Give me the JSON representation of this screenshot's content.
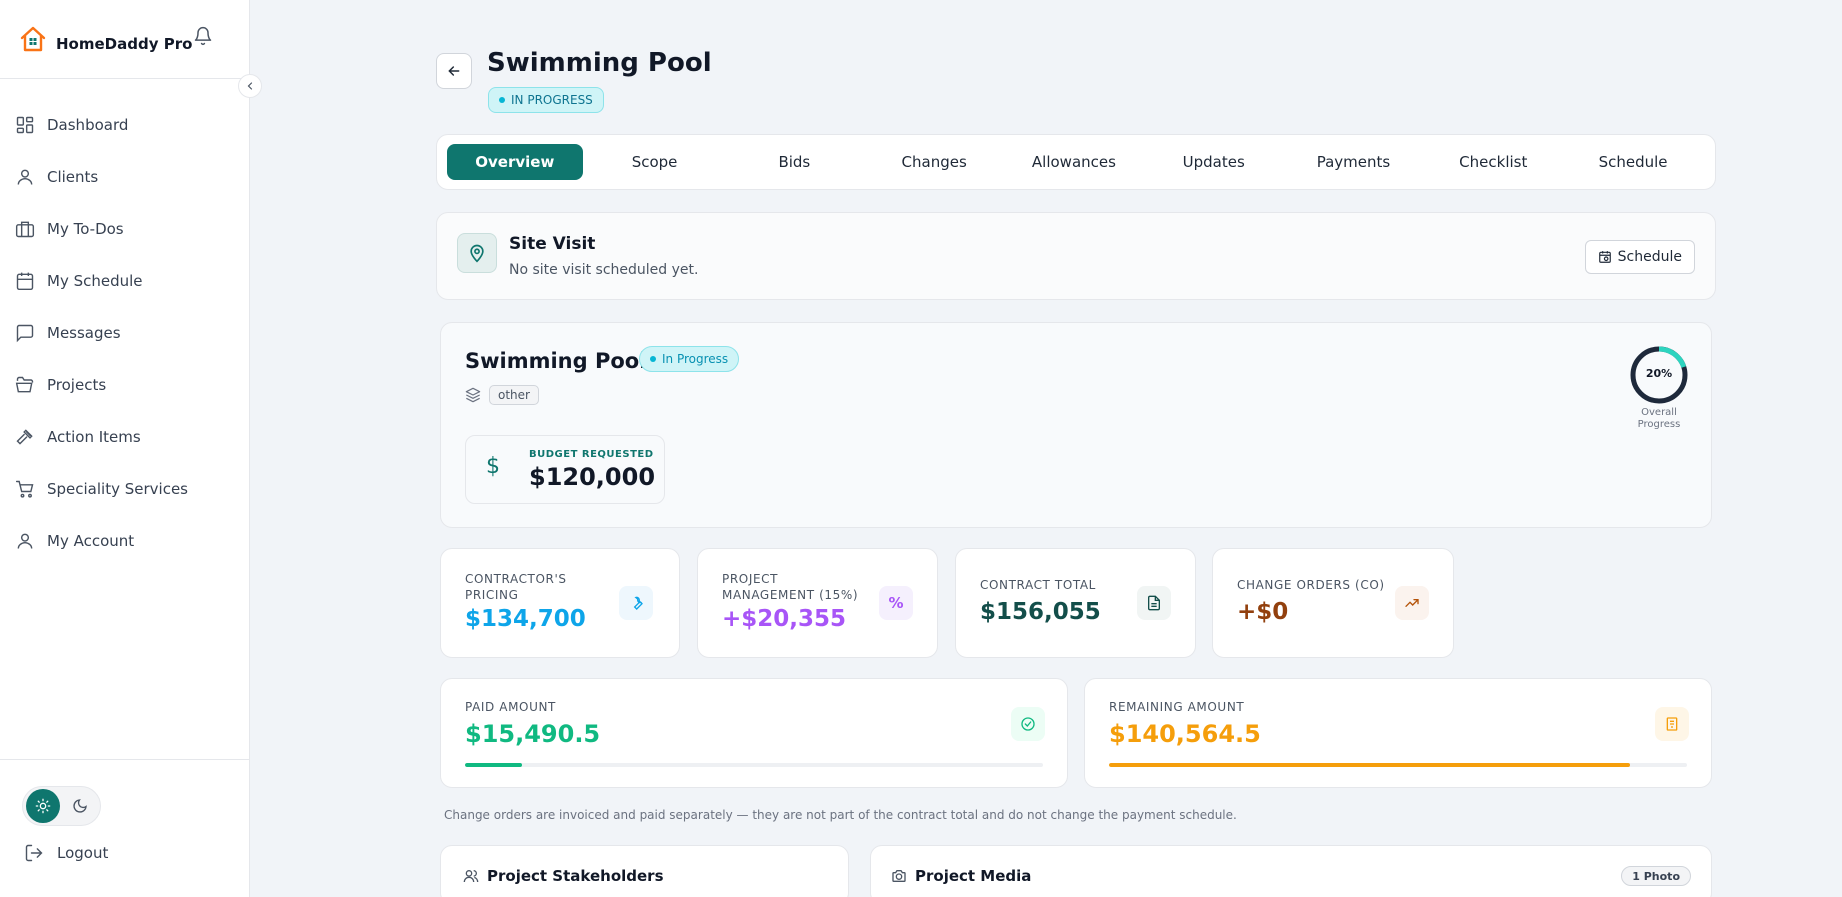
{
  "brand": {
    "name": "HomeDaddy Pro"
  },
  "nav": [
    {
      "label": "Dashboard",
      "icon": "dashboard-icon"
    },
    {
      "label": "Clients",
      "icon": "user-icon"
    },
    {
      "label": "My To-Dos",
      "icon": "briefcase-icon"
    },
    {
      "label": "My Schedule",
      "icon": "calendar-icon"
    },
    {
      "label": "Messages",
      "icon": "message-icon"
    },
    {
      "label": "Projects",
      "icon": "folder-icon"
    },
    {
      "label": "Action Items",
      "icon": "hammer-icon"
    },
    {
      "label": "Speciality Services",
      "icon": "cart-icon"
    },
    {
      "label": "My Account",
      "icon": "user-icon"
    }
  ],
  "logout_label": "Logout",
  "header": {
    "title": "Swimming Pool",
    "status": "IN PROGRESS"
  },
  "tabs": [
    "Overview",
    "Scope",
    "Bids",
    "Changes",
    "Allowances",
    "Updates",
    "Payments",
    "Checklist",
    "Schedule"
  ],
  "active_tab": "Overview",
  "site_visit": {
    "title": "Site Visit",
    "subtitle": "No site visit scheduled yet.",
    "button": "Schedule"
  },
  "project": {
    "title": "Swimming Pool",
    "status": "In Progress",
    "category": "other",
    "budget_label": "BUDGET REQUESTED",
    "budget_value": "$120,000",
    "progress_percent": 20,
    "progress_text": "20%",
    "progress_label_line1": "Overall",
    "progress_label_line2": "Progress"
  },
  "stats": {
    "contractor": {
      "label_line1": "CONTRACTOR'S",
      "label_line2": "PRICING",
      "value": "$134,700"
    },
    "management": {
      "label_line1": "PROJECT",
      "label_line2": "MANAGEMENT (15%)",
      "value": "+$20,355"
    },
    "contract": {
      "label": "CONTRACT TOTAL",
      "value": "$156,055"
    },
    "change_orders": {
      "label": "CHANGE ORDERS (CO)",
      "value": "+$0"
    }
  },
  "payments": {
    "paid": {
      "label": "PAID AMOUNT",
      "value": "$15,490.5",
      "fraction": 0.099
    },
    "remaining": {
      "label": "REMAINING AMOUNT",
      "value": "$140,564.5",
      "fraction": 0.901
    }
  },
  "note": "Change orders are invoiced and paid separately — they are not part of the contract total and do not change the payment schedule.",
  "stakeholders": {
    "title": "Project Stakeholders"
  },
  "media": {
    "title": "Project Media",
    "badge": "1 Photo"
  },
  "colors": {
    "primary": "#0f766e",
    "cyan": "#0ea5e9",
    "purple": "#a855f7",
    "teal_dark": "#134e4a",
    "brown": "#92400e",
    "green": "#10b981",
    "orange": "#f59e0b"
  }
}
